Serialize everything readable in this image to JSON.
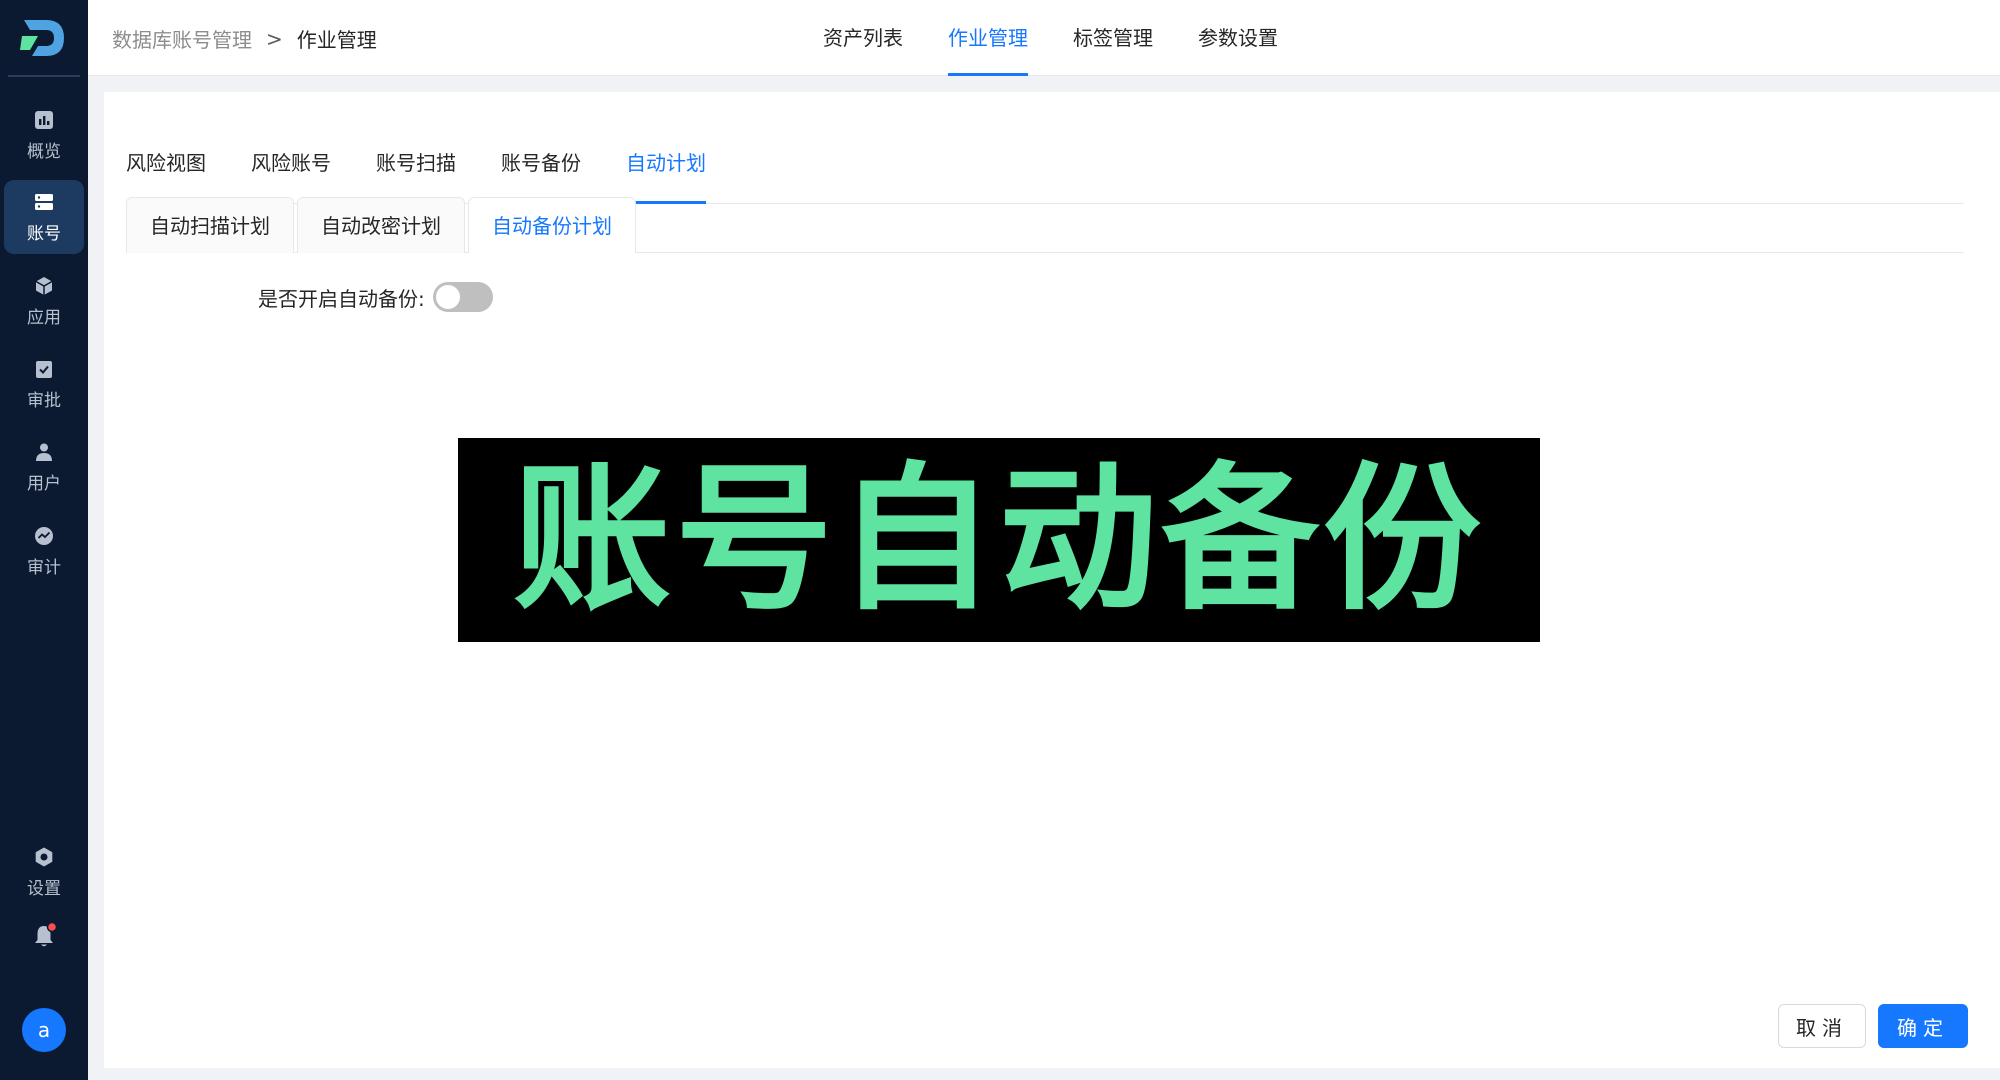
{
  "sidebar": {
    "items": [
      {
        "label": "概览",
        "icon": "bar-chart-icon"
      },
      {
        "label": "账号",
        "icon": "server-icon"
      },
      {
        "label": "应用",
        "icon": "cube-icon"
      },
      {
        "label": "审批",
        "icon": "clipboard-check-icon"
      },
      {
        "label": "用户",
        "icon": "user-icon"
      },
      {
        "label": "审计",
        "icon": "trend-circle-icon"
      }
    ],
    "active_index": 1,
    "settings_label": "设置",
    "avatar_letter": "a",
    "bell_badge_color": "#ff4d4f"
  },
  "header": {
    "breadcrumb": {
      "parent": "数据库账号管理",
      "separator": ">",
      "current": "作业管理"
    },
    "nav": [
      "资产列表",
      "作业管理",
      "标签管理",
      "参数设置"
    ],
    "active_nav": "作业管理"
  },
  "tabs": [
    "风险视图",
    "风险账号",
    "账号扫描",
    "账号备份",
    "自动计划"
  ],
  "active_tab": "自动计划",
  "subtabs": [
    "自动扫描计划",
    "自动改密计划",
    "自动备份计划"
  ],
  "active_subtab": "自动备份计划",
  "form": {
    "toggle_label": "是否开启自动备份:",
    "toggle_on": false
  },
  "banner_text": "账号自动备份",
  "buttons": {
    "cancel": "取消",
    "ok": "确定"
  },
  "colors": {
    "accent": "#1677ff",
    "sidebar_bg": "#0b1a30",
    "banner_text": "#5ee3a1"
  }
}
